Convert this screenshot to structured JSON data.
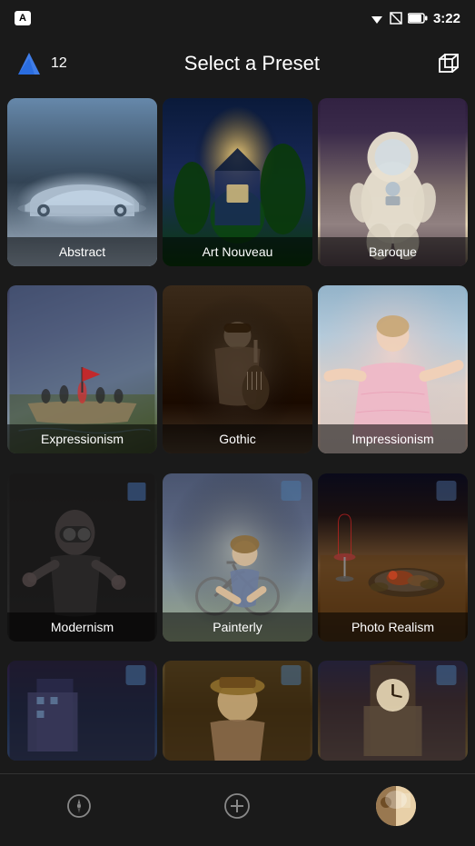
{
  "statusBar": {
    "badge": "A",
    "time": "3:22"
  },
  "header": {
    "count": "12",
    "title": "Select a Preset"
  },
  "presets": [
    {
      "id": "abstract",
      "label": "Abstract",
      "bgClass": "bg-abstract",
      "row": 1
    },
    {
      "id": "art-nouveau",
      "label": "Art Nouveau",
      "bgClass": "bg-art-nouveau",
      "row": 1
    },
    {
      "id": "baroque",
      "label": "Baroque",
      "bgClass": "bg-baroque",
      "row": 1
    },
    {
      "id": "expressionism",
      "label": "Expressionism",
      "bgClass": "bg-expressionism",
      "row": 2
    },
    {
      "id": "gothic",
      "label": "Gothic",
      "bgClass": "bg-gothic",
      "row": 2
    },
    {
      "id": "impressionism",
      "label": "Impressionism",
      "bgClass": "bg-impressionism",
      "row": 2
    },
    {
      "id": "modernism",
      "label": "Modernism",
      "bgClass": "bg-modernism",
      "row": 3
    },
    {
      "id": "painterly",
      "label": "Painterly",
      "bgClass": "bg-painterly",
      "row": 3
    },
    {
      "id": "photo-realism",
      "label": "Photo Realism",
      "bgClass": "bg-photo-realism",
      "row": 3
    },
    {
      "id": "row4a",
      "label": "",
      "bgClass": "bg-row4a",
      "row": 4,
      "partial": true
    },
    {
      "id": "row4b",
      "label": "",
      "bgClass": "bg-row4b",
      "row": 4,
      "partial": true
    },
    {
      "id": "row4c",
      "label": "",
      "bgClass": "bg-row4c",
      "row": 4,
      "partial": true
    }
  ],
  "nav": {
    "compass_label": "compass",
    "add_label": "add",
    "avatar_label": "profile"
  }
}
